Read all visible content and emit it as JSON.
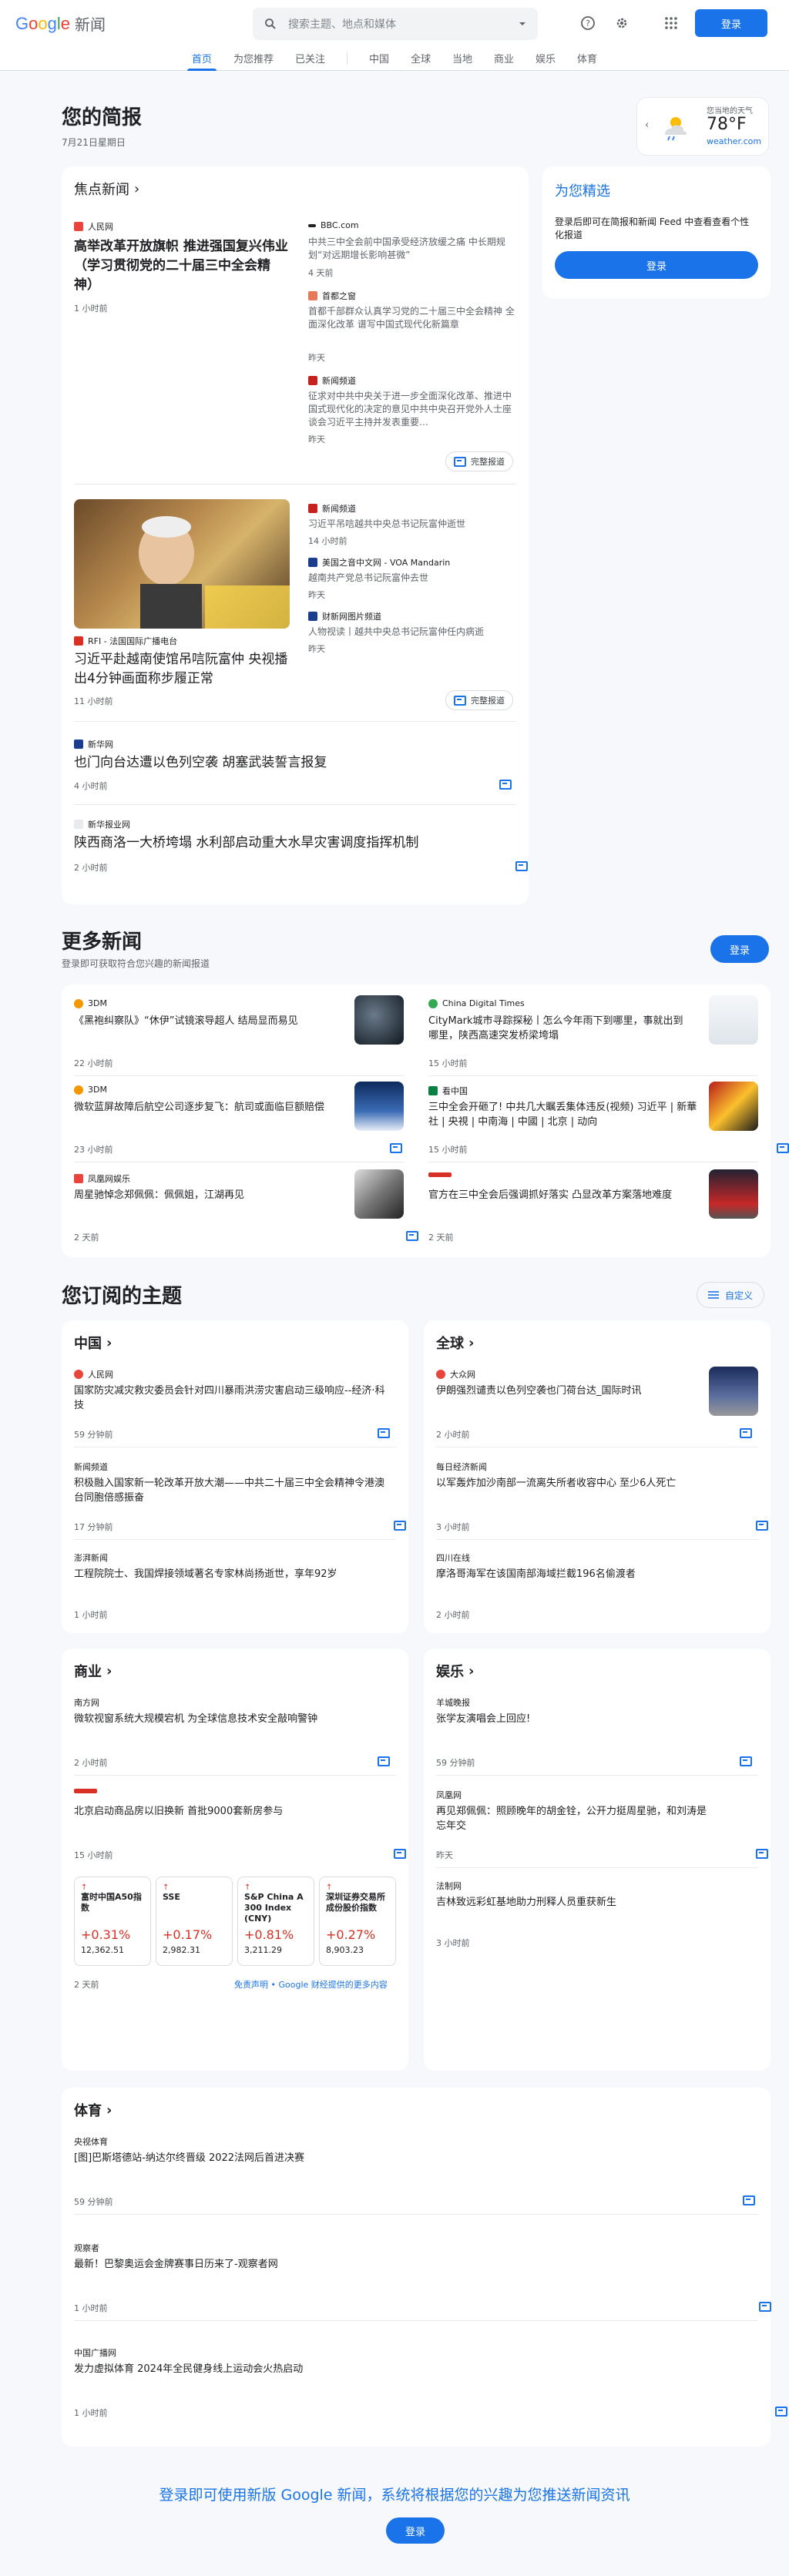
{
  "header": {
    "logo_google": [
      "G",
      "o",
      "o",
      "g",
      "l",
      "e"
    ],
    "logo_news": "新闻",
    "search_placeholder": "搜索主题、地点和媒体",
    "signin": "登录"
  },
  "nav": [
    "首页",
    "为您推荐",
    "已关注",
    "中国",
    "全球",
    "当地",
    "商业",
    "娱乐",
    "体育"
  ],
  "briefing": {
    "title": "您的简报",
    "date": "7月21日星期日"
  },
  "weather": {
    "label": "您当地的天气",
    "temp": "78°F",
    "source": "weather.com"
  },
  "top": {
    "title": "焦点新闻",
    "full_coverage": "完整报道",
    "main1": {
      "source": "人民网",
      "title": "高举改革开放旗帜 推进强国复兴伟业（学习贯彻党的二十届三中全会精神）",
      "time": "1 小时前"
    },
    "side1": [
      {
        "source": "BBC.com",
        "title": "中共三中全会前中国承受经济放缓之痛 中长期规划“对远期增长影响甚微”",
        "time": "4 天前"
      },
      {
        "source": "首都之窗",
        "title": "首都千部群众认真学习党的二十届三中全会精神 全面深化改革 谱写中国式现代化新篇章",
        "time": "昨天"
      },
      {
        "source": "新闻频道",
        "title": "征求对中共中央关于进一步全面深化改革、推进中国式现代化的决定的意见中共中央召开党外人士座谈会习近平主持并发表重要…",
        "time": "昨天"
      }
    ],
    "main2": {
      "source": "RFI - 法国国际广播电台",
      "title": "习近平赴越南使馆吊唁阮富仲 央视播出4分钟画面称步履正常",
      "time": "11 小时前"
    },
    "side2": [
      {
        "source": "新闻频道",
        "title": "习近平吊唁越共中央总书记阮富仲逝世",
        "time": "14 小时前"
      },
      {
        "source": "美国之音中文网 - VOA Mandarin",
        "title": "越南共产党总书记阮富仲去世",
        "time": "昨天"
      },
      {
        "source": "财新网图片频道",
        "title": "人物视读丨越共中央总书记阮富仲任内病逝",
        "time": "昨天"
      }
    ],
    "extra": [
      {
        "source": "新华网",
        "title": "也门胡塞武装誓言报复",
        "title_full": "也门向台达遭以色列空袭 胡塞武装誓言报复",
        "time": "4 小时前"
      },
      {
        "source": "新华报业网",
        "title": "陕西商洛一大桥垮塌 水利部启动重大水旱灾害调度指挥机制",
        "time": "2 小时前"
      }
    ]
  },
  "picks": {
    "title": "为您精选",
    "text": "登录后即可在简报和新闻 Feed 中查看查看个性化报道",
    "button": "登录"
  },
  "more": {
    "title": "更多新闻",
    "subtitle": "登录即可获取符合您兴趣的新闻报道",
    "signin": "登录",
    "items": [
      {
        "source": "3DM",
        "title": "《黑袍纠察队》“休伊”试镜滚导超人 结局显而易见",
        "time": "22 小时前"
      },
      {
        "source": "China Digital Times",
        "title": "CityMark城市寻踪探秘丨怎么今年雨下到哪里，事就出到哪里，陕西高速突发桥梁垮塌",
        "time": "15 小时前"
      },
      {
        "source": "3DM",
        "title": "微软蓝屏故障后航空公司逐步复飞：航司或面临巨额赔偿",
        "time": "23 小时前"
      },
      {
        "source": "看中国",
        "title": "三中全会开砸了! 中共几大瞩丢集体违反(视频) 习近平 | 新華社 | 央視 | 中南海 | 中國 | 北京 | 动向",
        "time": "15 小时前"
      },
      {
        "source": "凤凰网娱乐",
        "title": "周星驰悼念郑佩佩：佩佩姐，江湖再见",
        "time": "2 天前"
      },
      {
        "source": "",
        "title": "官方在三中全会后强调抓好落实 凸显改革方案落地难度",
        "time": "2 天前"
      }
    ]
  },
  "topics": {
    "title": "您订阅的主题",
    "customize": "自定义",
    "china": {
      "title": "中国",
      "items": [
        {
          "source": "人民网",
          "title": "国家防灾减灾救灾委员会针对四川暴雨洪涝灾害启动三级响应--经济·科技",
          "time": "59 分钟前"
        },
        {
          "source": "新闻频道",
          "title": "积极融入国家新一轮改革开放大潮——中共二十届三中全会精神令港澳台同胞倍感振奋",
          "time": "17 分钟前"
        },
        {
          "source": "澎湃新闻",
          "title": "工程院院士、我国焊接领域著名专家林尚扬逝世，享年92岁",
          "time": "1 小时前"
        }
      ]
    },
    "world": {
      "title": "全球",
      "items": [
        {
          "source": "大众网",
          "title": "伊朗强烈谴责以色列空袭也门荷台达_国际时讯",
          "time": "2 小时前"
        },
        {
          "source": "每日经济新闻",
          "title": "以军轰炸加沙南部一流离失所者收容中心 至少6人死亡",
          "time": "3 小时前"
        },
        {
          "source": "四川在线",
          "title": "摩洛哥海军在该国南部海域拦截196名偷渡者",
          "time": "2 小时前"
        }
      ]
    },
    "business": {
      "title": "商业",
      "items": [
        {
          "source": "南方网",
          "title": "微软视窗系统大规模宕机 为全球信息技术安全敲响警钟",
          "time": "2 小时前"
        },
        {
          "source": "",
          "title": "北京启动商品房以旧换新 首批9000套新房参与",
          "time": "15 小时前"
        }
      ],
      "stocks": [
        {
          "name": "富时中国A50指数",
          "pct": "+0.31%",
          "val": "12,362.51"
        },
        {
          "name": "SSE",
          "pct": "+0.17%",
          "val": "2,982.31"
        },
        {
          "name": "S&P China A 300 Index (CNY)",
          "pct": "+0.81%",
          "val": "3,211.29"
        },
        {
          "name": "深圳证券交易所成份股价指数",
          "pct": "+0.27%",
          "val": "8,903.23"
        }
      ],
      "stock_time": "2 天前",
      "disclaimer": "免责声明 • Google 财经提供的更多内容"
    },
    "ent": {
      "title": "娱乐",
      "items": [
        {
          "source": "羊城晚报",
          "title": "张学友演唱会上回应!",
          "time": "59 分钟前"
        },
        {
          "source": "凤凰网",
          "title": "再见郑佩佩：照顾晚年的胡金铨，公开力挺周星驰，和刘涛是忘年交",
          "time": "昨天"
        },
        {
          "source": "法制网",
          "title": "吉林致远彩虹基地助力刑释人员重获新生",
          "time": "3 小时前"
        }
      ]
    },
    "sports": {
      "title": "体育",
      "items": [
        {
          "source": "央视体育",
          "title": "[图]巴斯塔德站-纳达尔终晋级 2022法网后首进决赛",
          "time": "59 分钟前"
        },
        {
          "source": "观察者",
          "title": "最新！巴黎奥运会金牌赛事日历来了-观察者网",
          "time": "1 小时前"
        },
        {
          "source": "中国广播网",
          "title": "发力虚拟体育 2024年全民健身线上运动会火热启动",
          "time": "1 小时前"
        }
      ]
    }
  },
  "footer": {
    "text": "登录即可使用新版 Google 新闻，系统将根据您的兴趣为您推送新闻资讯",
    "button": "登录"
  },
  "colors": {
    "accent": "#1a73e8",
    "up": "#d93025"
  }
}
